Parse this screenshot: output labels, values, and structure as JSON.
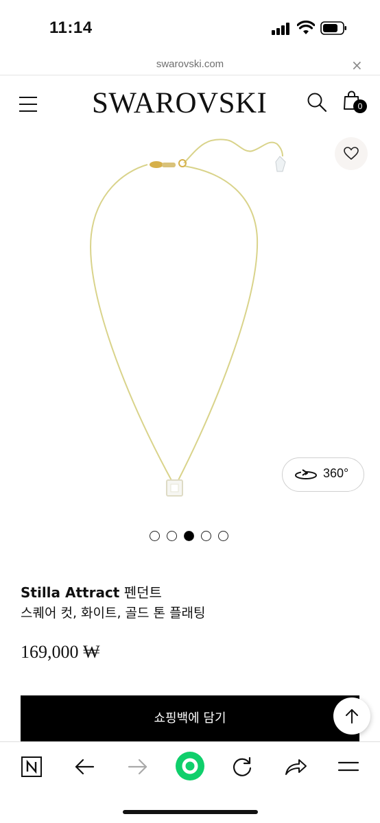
{
  "status_bar": {
    "time": "11:14"
  },
  "url_bar": {
    "url": "swarovski.com",
    "close_glyph": "×"
  },
  "header": {
    "brand": "SWAROVSKI",
    "bag_count": "0",
    "icons": [
      "menu-icon",
      "search-icon",
      "shopping-bag-icon"
    ]
  },
  "gallery": {
    "view_360_label": "360°",
    "dot_count": 5,
    "active_dot": 3,
    "icons": [
      "heart-icon",
      "rotate-360-icon"
    ]
  },
  "product": {
    "name": "Stilla Attract",
    "type": "펜던트",
    "subtitle": "스퀘어 컷, 화이트, 골드 톤 플래팅",
    "price": "169,000 ₩"
  },
  "actions": {
    "add_to_bag": "쇼핑백에 담기"
  },
  "browser_toolbar": {
    "items": [
      "naver-n-icon",
      "back-arrow-icon",
      "forward-arrow-icon",
      "green-home-icon",
      "reload-icon",
      "share-icon",
      "hamburger-menu-icon"
    ]
  },
  "colors": {
    "accent_green": "#0fcf6b",
    "chain_gold": "#d9d38a",
    "button_black": "#000000",
    "url_gray": "#6f6f6f"
  }
}
